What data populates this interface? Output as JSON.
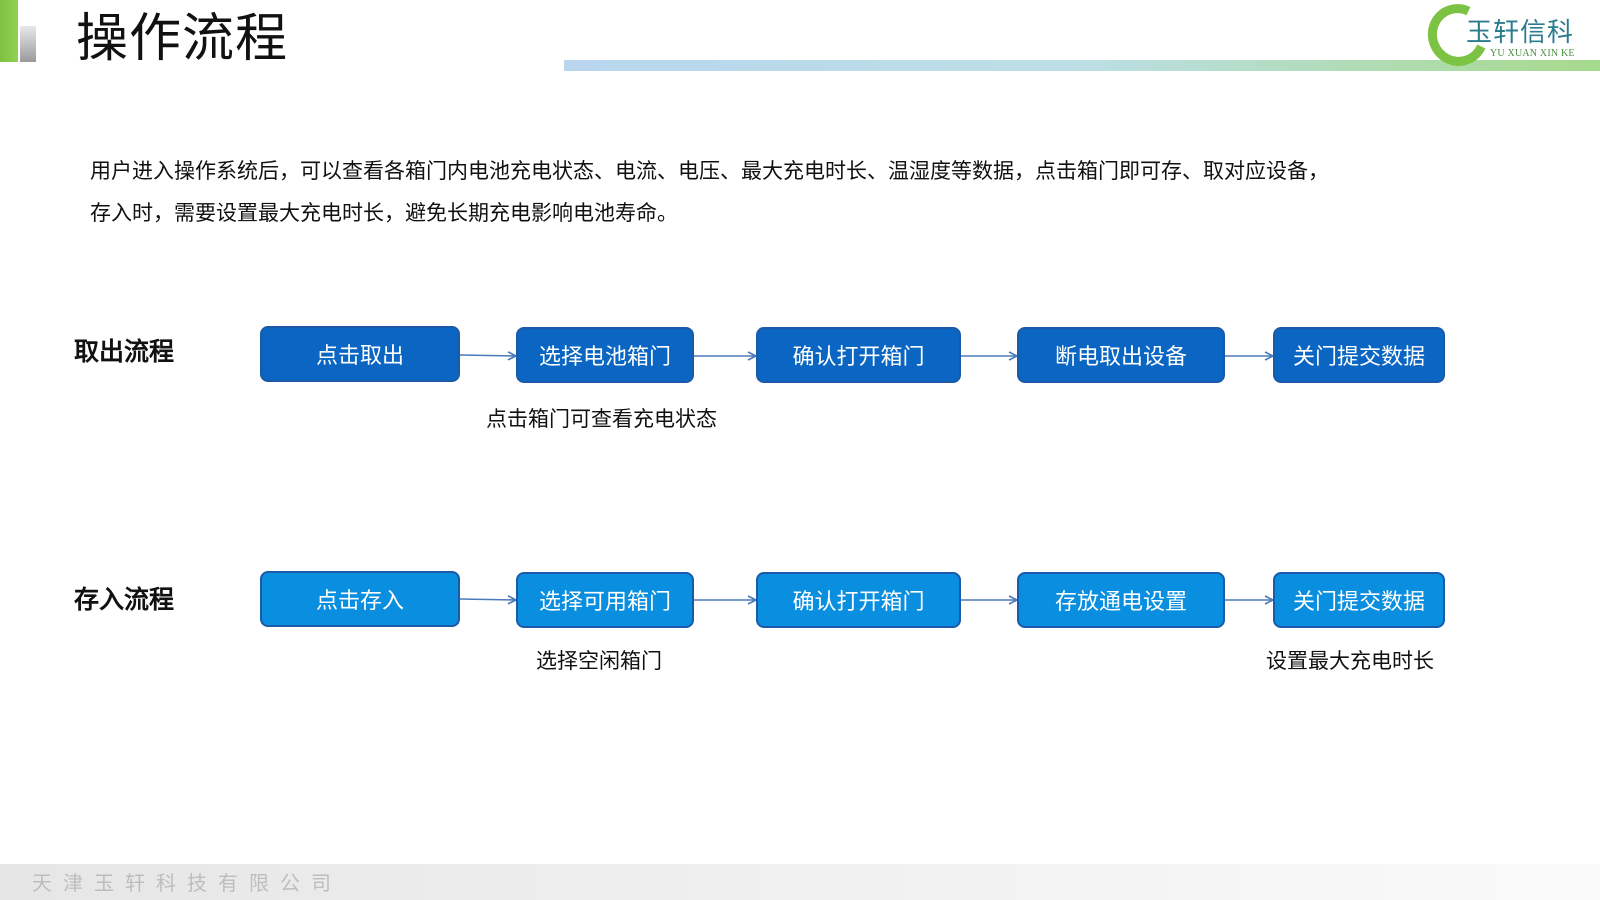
{
  "header": {
    "title": "操作流程",
    "logo_text": "玉轩信科",
    "logo_sub": "YU XUAN XIN KE"
  },
  "intro": {
    "line1": "用户进入操作系统后，可以查看各箱门内电池充电状态、电流、电压、最大充电时长、温湿度等数据，点击箱门即可存、取对应设备，",
    "line2": "存入时，需要设置最大充电时长，避免长期充电影响电池寿命。"
  },
  "flows": {
    "takeout": {
      "label": "取出流程",
      "steps": [
        "点击取出",
        "选择电池箱门",
        "确认打开箱门",
        "断电取出设备",
        "关门提交数据"
      ],
      "note_step2": "点击箱门可查看充电状态"
    },
    "deposit": {
      "label": "存入流程",
      "steps": [
        "点击存入",
        "选择可用箱门",
        "确认打开箱门",
        "存放通电设置",
        "关门提交数据"
      ],
      "note_step2": "选择空闲箱门",
      "note_step5": "设置最大充电时长"
    }
  },
  "colors": {
    "box_dark": "#0a66c2",
    "box_light": "#0a8ee0",
    "arrow": "#4a7ab8",
    "accent_green": "#7cc243"
  },
  "footer": {
    "company": "天津玉轩科技有限公司"
  }
}
